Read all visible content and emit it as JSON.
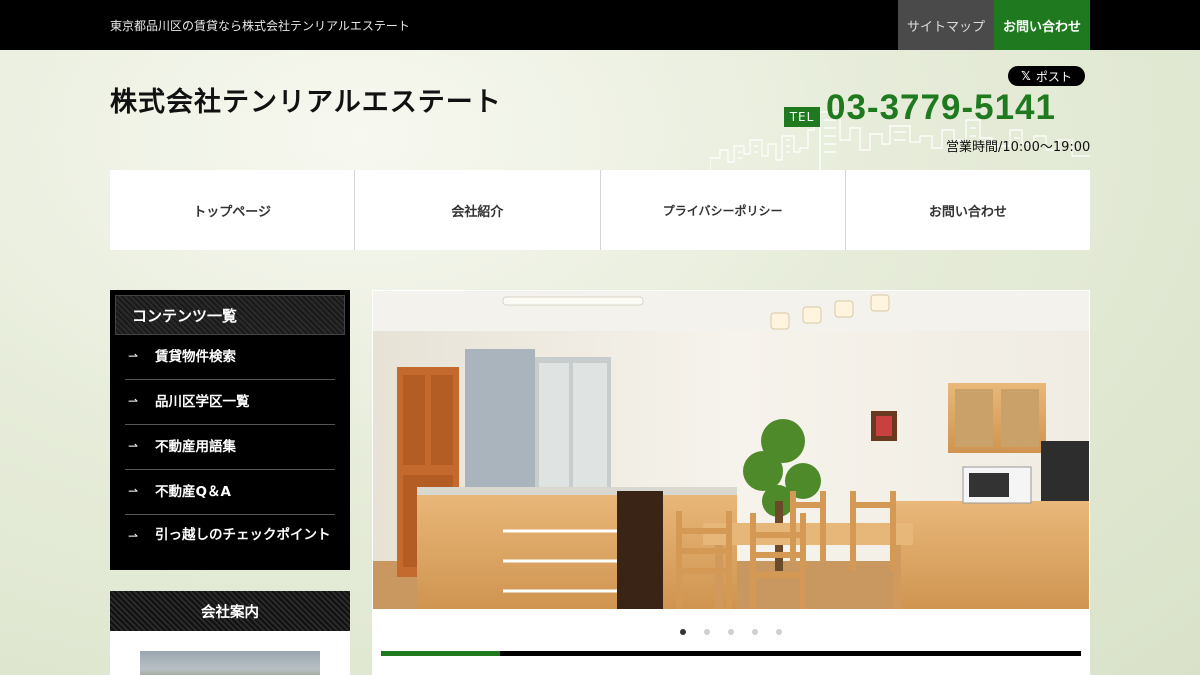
{
  "topbar": {
    "tagline": "東京都品川区の賃貸なら株式会社テンリアルエステート",
    "sitemap_label": "サイトマップ",
    "contact_label": "お問い合わせ"
  },
  "header": {
    "company_name": "株式会社テンリアルエステート",
    "post_label": "ポスト",
    "post_icon": "x-logo-icon",
    "tel_badge": "TEL",
    "tel_number": "03-3779-5141",
    "hours": "営業時間/10:00〜19:00"
  },
  "nav": {
    "items": [
      {
        "label": "トップページ"
      },
      {
        "label": "会社紹介"
      },
      {
        "label": "プライバシーポリシー"
      },
      {
        "label": "お問い合わせ"
      }
    ]
  },
  "sidebar": {
    "contents_title": "コンテンツ一覧",
    "items": [
      {
        "label": "賃貸物件検索"
      },
      {
        "label": "品川区学区一覧"
      },
      {
        "label": "不動産用語集"
      },
      {
        "label": "不動産Q＆A"
      },
      {
        "label": "引っ越しのチェックポイント"
      }
    ],
    "company_title": "会社案内"
  },
  "slider": {
    "slide_count": 5,
    "active_slide": 1,
    "progress": 0.17
  },
  "colors": {
    "brand_green": "#1f7a1f",
    "topbar_bg": "#000000",
    "sitemap_bg": "#4a4a4a"
  }
}
